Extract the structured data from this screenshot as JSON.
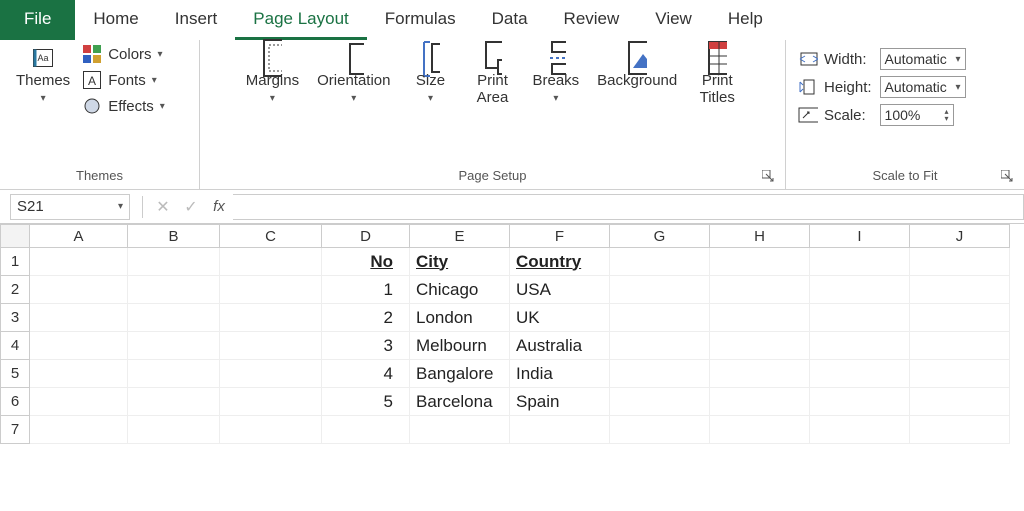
{
  "tabs": {
    "file": "File",
    "home": "Home",
    "insert": "Insert",
    "pagelayout": "Page Layout",
    "formulas": "Formulas",
    "data": "Data",
    "review": "Review",
    "view": "View",
    "help": "Help",
    "active": "pagelayout"
  },
  "ribbon": {
    "themes": {
      "label": "Themes",
      "themes_btn": "Themes",
      "colors": "Colors",
      "fonts": "Fonts",
      "effects": "Effects"
    },
    "pagesetup": {
      "label": "Page Setup",
      "margins": "Margins",
      "orientation": "Orientation",
      "size": "Size",
      "printarea": "Print\nArea",
      "breaks": "Breaks",
      "background": "Background",
      "printtitles": "Print\nTitles"
    },
    "scale": {
      "label": "Scale to Fit",
      "width_lbl": "Width:",
      "width_val": "Automatic",
      "height_lbl": "Height:",
      "height_val": "Automatic",
      "scale_lbl": "Scale:",
      "scale_val": "100%"
    }
  },
  "formula_bar": {
    "cellref": "S21",
    "formula": ""
  },
  "sheet": {
    "columns": [
      "A",
      "B",
      "C",
      "D",
      "E",
      "F",
      "G",
      "H",
      "I",
      "J"
    ],
    "rows": [
      "1",
      "2",
      "3",
      "4",
      "5",
      "6",
      "7"
    ],
    "headers": {
      "D": "No",
      "E": "City",
      "F": "Country"
    },
    "data": [
      {
        "no": "1",
        "city": "Chicago",
        "country": "USA"
      },
      {
        "no": "2",
        "city": "London",
        "country": "UK"
      },
      {
        "no": "3",
        "city": "Melbourn",
        "country": "Australia"
      },
      {
        "no": "4",
        "city": "Bangalore",
        "country": "India"
      },
      {
        "no": "5",
        "city": "Barcelona",
        "country": "Spain"
      }
    ]
  }
}
